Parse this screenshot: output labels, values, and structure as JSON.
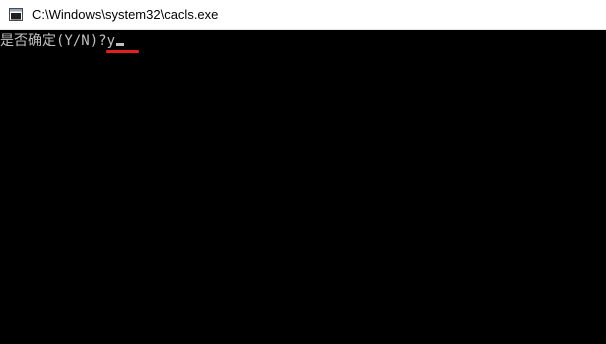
{
  "window": {
    "title": "C:\\Windows\\system32\\cacls.exe",
    "icon": "console-app-icon"
  },
  "console": {
    "prompt_text": "是否确定",
    "prompt_choices": "(Y/N)?",
    "typed_answer": "y",
    "cursor": "blinking-underscore"
  },
  "colors": {
    "console_background": "#000000",
    "console_text": "#c0c0c0",
    "titlebar_background": "#ffffff",
    "annotation_underline": "#e02020"
  }
}
